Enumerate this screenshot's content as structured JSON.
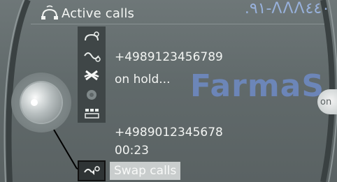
{
  "header": {
    "title": "Active calls",
    "watermark": ".٩١-ΛΛΛ٤٤٠"
  },
  "watermark_center": "FarmaS",
  "calls": [
    {
      "number": "+4989123456789",
      "status": "on hold..."
    },
    {
      "number": "+4989012345678",
      "status": "00:23"
    }
  ],
  "icon_strip": {
    "items": [
      {
        "icon": "handset-with-signal-icon"
      },
      {
        "icon": "call-transfer-icon"
      },
      {
        "icon": "end-call-icon"
      },
      {
        "icon": "disabled-options-icon"
      },
      {
        "icon": "keypad-icon"
      }
    ]
  },
  "swap": {
    "label": "Swap calls",
    "icon": "swap-calls-icon"
  },
  "right_knob_label": "on",
  "colors": {
    "screen_bg": "#616a6b",
    "strip_bg": "#3f4647",
    "highlight_bg": "#c9cdcd",
    "text": "#f2f4f2",
    "watermark_blue": "#6f8bc6"
  }
}
